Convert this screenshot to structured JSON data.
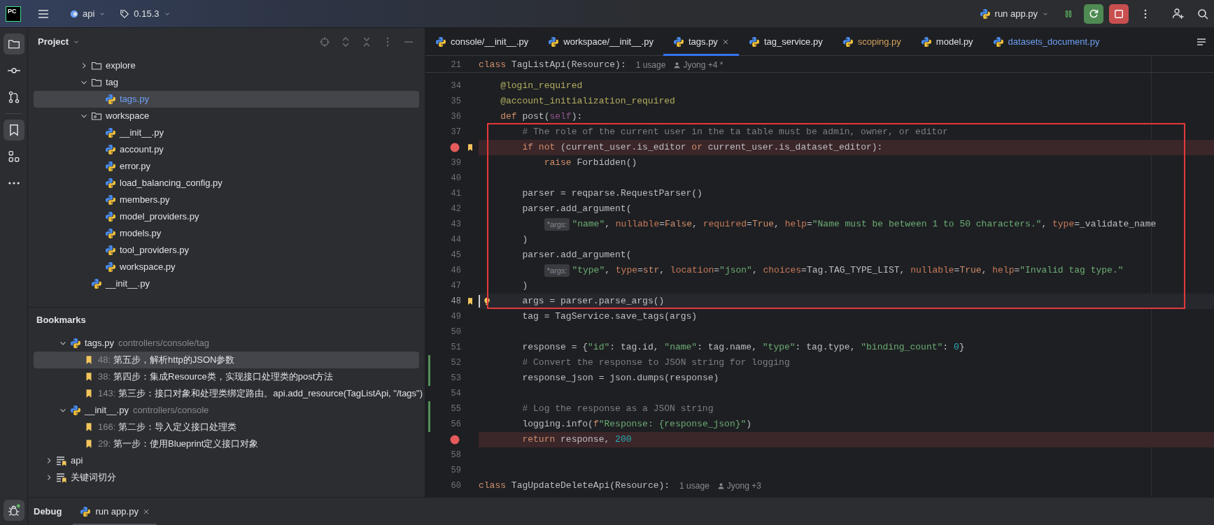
{
  "top_bar": {
    "logo": "PC",
    "project": "api",
    "branch": "0.15.3",
    "run_config": "run app.py"
  },
  "tool_strip": [
    {
      "kind": "project",
      "selected": true
    },
    {
      "kind": "commit",
      "selected": false
    },
    {
      "kind": "pull-requests",
      "selected": false
    },
    {
      "kind": "bookmarks",
      "selected": true
    },
    {
      "kind": "structure",
      "selected": false
    },
    {
      "kind": "more",
      "selected": false
    }
  ],
  "project_panel": {
    "title": "Project",
    "tree": [
      {
        "name": "explore",
        "kind": "folder",
        "expanded": false
      },
      {
        "name": "tag",
        "kind": "folder",
        "expanded": true,
        "children": [
          {
            "name": "tags.py",
            "kind": "file",
            "selected": true,
            "modified": true
          }
        ]
      },
      {
        "name": "workspace",
        "kind": "package",
        "expanded": true,
        "children": [
          {
            "name": "__init__.py",
            "kind": "file",
            "selected": false,
            "modified": false
          },
          {
            "name": "account.py",
            "kind": "file",
            "selected": false,
            "modified": false
          },
          {
            "name": "error.py",
            "kind": "file",
            "selected": false,
            "modified": false
          },
          {
            "name": "load_balancing_config.py",
            "kind": "file",
            "selected": false,
            "modified": false
          },
          {
            "name": "members.py",
            "kind": "file",
            "selected": false,
            "modified": false
          },
          {
            "name": "model_providers.py",
            "kind": "file",
            "selected": false,
            "modified": false
          },
          {
            "name": "models.py",
            "kind": "file",
            "selected": false,
            "modified": false
          },
          {
            "name": "tool_providers.py",
            "kind": "file",
            "selected": false,
            "modified": false
          },
          {
            "name": "workspace.py",
            "kind": "file",
            "selected": false,
            "modified": false
          }
        ]
      },
      {
        "name": "__init__.py",
        "kind": "file",
        "selected": false,
        "modified": false
      }
    ]
  },
  "bookmarks_panel": {
    "title": "Bookmarks",
    "items": [
      {
        "kind": "file",
        "name": "tags.py",
        "path": "controllers/console/tag",
        "expanded": true,
        "children": [
          {
            "line": "48:",
            "text": "第五步，解析http的JSON参数",
            "selected": true
          },
          {
            "line": "38:",
            "text": "第四步：集成Resource类，实现接口处理类的post方法",
            "selected": false
          },
          {
            "line": "143:",
            "text": "第三步：接口对象和处理类绑定路由。api.add_resource(TagListApi, \"/tags\")",
            "selected": false
          }
        ]
      },
      {
        "kind": "file",
        "name": "__init__.py",
        "path": "controllers/console",
        "expanded": true,
        "children": [
          {
            "line": "166:",
            "text": "第二步：导入定义接口处理类",
            "selected": false
          },
          {
            "line": "29:",
            "text": "第一步：使用Blueprint定义接口对象",
            "selected": false
          }
        ]
      },
      {
        "kind": "list",
        "name": "api",
        "expanded": false
      },
      {
        "kind": "list",
        "name": "关键词切分",
        "expanded": false
      }
    ]
  },
  "editor": {
    "tabs": [
      {
        "label": "console/__init__.py",
        "selected": false,
        "color": "#dfe1e5"
      },
      {
        "label": "workspace/__init__.py",
        "selected": false,
        "color": "#dfe1e5"
      },
      {
        "label": "tags.py",
        "selected": true,
        "color": "#dfe1e5"
      },
      {
        "label": "tag_service.py",
        "selected": false,
        "color": "#dfe1e5"
      },
      {
        "label": "scoping.py",
        "selected": false,
        "color": "#d0a05e"
      },
      {
        "label": "model.py",
        "selected": false,
        "color": "#dfe1e5"
      },
      {
        "label": "datasets_document.py",
        "selected": false,
        "color": "#6e9ff4"
      }
    ],
    "sticky_header": {
      "number": "21",
      "code": "class TagListApi(Resource):",
      "usages": "1 usage",
      "author": "Jyong +4 *"
    },
    "blocks": [
      {
        "boxed": false,
        "lines": [
          {
            "number": "34",
            "code": "    @login_required",
            "breakpoint": false,
            "bookmark": false,
            "changed": false,
            "current": false
          },
          {
            "number": "35",
            "code": "    @account_initialization_required",
            "breakpoint": false,
            "bookmark": false,
            "changed": false,
            "current": false
          },
          {
            "number": "36",
            "code": "    def post(self):",
            "breakpoint": false,
            "bookmark": false,
            "changed": false,
            "current": false
          }
        ]
      },
      {
        "boxed": true,
        "lines": [
          {
            "number": "37",
            "code": "        # The role of the current user in the ta table must be admin, owner, or editor",
            "breakpoint": false,
            "bookmark": false,
            "changed": false,
            "current": false
          },
          {
            "code": "        if not (current_user.is_editor or current_user.is_dataset_editor):",
            "breakpoint": true,
            "bookmark": true,
            "changed": false,
            "current": false
          },
          {
            "number": "39",
            "code": "            raise Forbidden()",
            "breakpoint": false,
            "bookmark": false,
            "changed": false,
            "current": false
          },
          {
            "number": "40",
            "breakpoint": false,
            "bookmark": false,
            "changed": false,
            "current": false
          },
          {
            "number": "41",
            "code": "        parser = reqparse.RequestParser()",
            "breakpoint": false,
            "bookmark": false,
            "changed": false,
            "current": false
          },
          {
            "number": "42",
            "code": "        parser.add_argument(",
            "breakpoint": false,
            "bookmark": false,
            "changed": false,
            "current": false
          },
          {
            "number": "43",
            "hint": "*args:",
            "code": "            \"name\", nullable=False, required=True, help=\"Name must be between 1 to 50 characters.\", type=_validate_name",
            "breakpoint": false,
            "bookmark": false,
            "changed": false,
            "current": false
          },
          {
            "number": "44",
            "code": "        )",
            "breakpoint": false,
            "bookmark": false,
            "changed": false,
            "current": false
          },
          {
            "number": "45",
            "code": "        parser.add_argument(",
            "breakpoint": false,
            "bookmark": false,
            "changed": false,
            "current": false
          },
          {
            "number": "46",
            "hint": "*args:",
            "code": "            \"type\", type=str, location=\"json\", choices=Tag.TAG_TYPE_LIST, nullable=True, help=\"Invalid tag type.\"",
            "breakpoint": false,
            "bookmark": false,
            "changed": false,
            "current": false
          },
          {
            "number": "47",
            "code": "        )",
            "breakpoint": false,
            "bookmark": false,
            "changed": false,
            "current": false
          },
          {
            "number": "48",
            "code": "        args = parser.parse_args()",
            "breakpoint": false,
            "bookmark": true,
            "changed": false,
            "current": true
          }
        ]
      },
      {
        "boxed": false,
        "lines": [
          {
            "number": "49",
            "code": "        tag = TagService.save_tags(args)",
            "breakpoint": false,
            "bookmark": false,
            "changed": false,
            "current": false
          },
          {
            "number": "50",
            "breakpoint": false,
            "bookmark": false,
            "changed": false,
            "current": false
          },
          {
            "number": "51",
            "code": "        response = {\"id\": tag.id, \"name\": tag.name, \"type\": tag.type, \"binding_count\": 0}",
            "breakpoint": false,
            "bookmark": false,
            "changed": false,
            "current": false
          },
          {
            "number": "52",
            "code": "        # Convert the response to JSON string for logging",
            "breakpoint": false,
            "bookmark": false,
            "changed": true,
            "current": false
          },
          {
            "number": "53",
            "code": "        response_json = json.dumps(response)",
            "breakpoint": false,
            "bookmark": false,
            "changed": true,
            "current": false
          },
          {
            "number": "54",
            "breakpoint": false,
            "bookmark": false,
            "changed": false,
            "current": false
          },
          {
            "number": "55",
            "code": "        # Log the response as a JSON string",
            "breakpoint": false,
            "bookmark": false,
            "changed": true,
            "current": false
          },
          {
            "number": "56",
            "code": "        logging.info(f\"Response: {response_json}\")",
            "breakpoint": false,
            "bookmark": false,
            "changed": true,
            "current": false
          },
          {
            "code": "        return response, 200",
            "breakpoint": true,
            "bookmark": false,
            "changed": false,
            "current": false
          },
          {
            "number": "58",
            "breakpoint": false,
            "bookmark": false,
            "changed": false,
            "current": false
          },
          {
            "number": "59",
            "breakpoint": false,
            "bookmark": false,
            "changed": false,
            "current": false
          },
          {
            "number": "60",
            "code": "class TagUpdateDeleteApi(Resource):",
            "usages": "1 usage",
            "author": "Jyong +3",
            "breakpoint": false,
            "bookmark": false,
            "changed": false,
            "current": false
          }
        ]
      }
    ]
  },
  "debug_bar": {
    "title": "Debug",
    "tabs": [
      {
        "label": "run app.py",
        "selected": true
      }
    ]
  }
}
